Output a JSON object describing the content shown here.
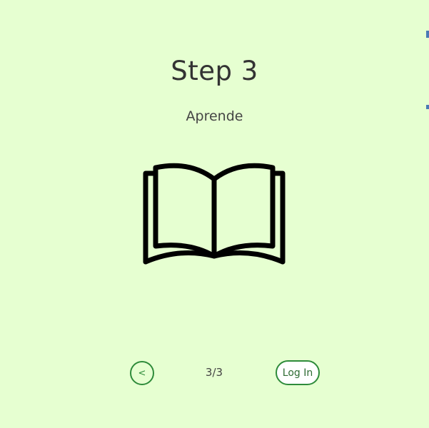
{
  "step": {
    "title": "Step 3",
    "subtitle": "Aprende"
  },
  "icon": {
    "name": "open-book-icon",
    "color": "#000000"
  },
  "navigation": {
    "back_label": "<",
    "page_indicator": "3/3",
    "login_label": "Log In"
  },
  "colors": {
    "background": "#e6ffd1",
    "accent": "#2e8b3a",
    "text": "#333333"
  }
}
